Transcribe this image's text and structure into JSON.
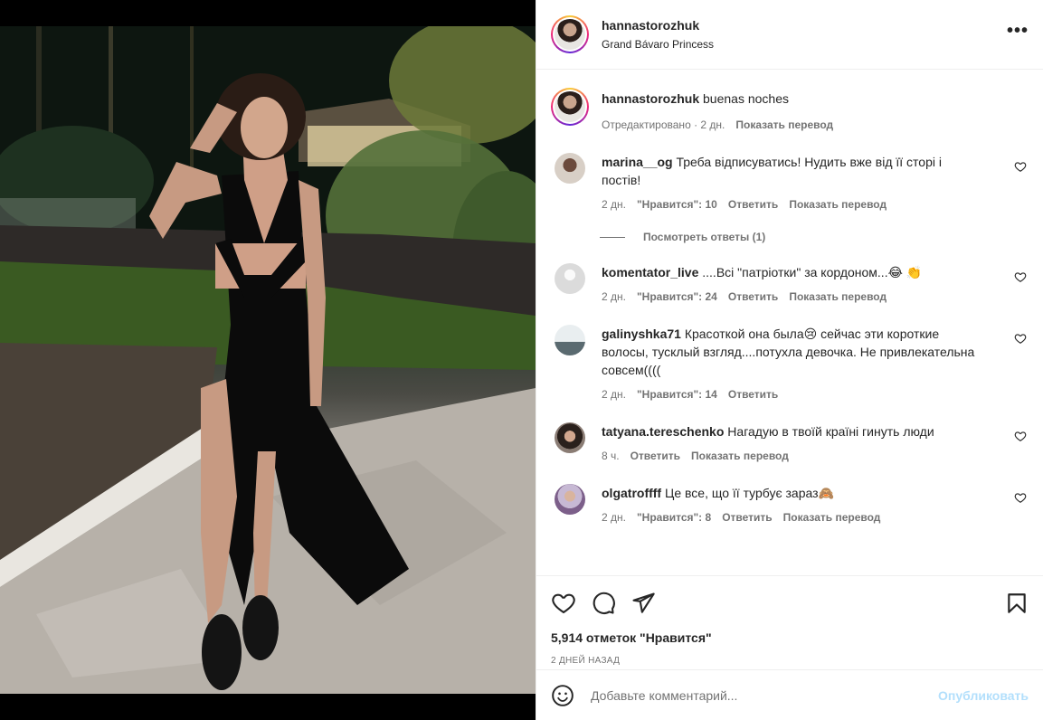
{
  "post": {
    "username": "hannastorozhuk",
    "location": "Grand Bávaro Princess",
    "more_label": "•••"
  },
  "caption": {
    "username": "hannastorozhuk",
    "text": "buenas noches",
    "edited": "Отредактировано · 2 дн.",
    "translate": "Показать перевод"
  },
  "comments": [
    {
      "username": "marina__og",
      "text": "Треба відписуватись! Нудить вже від її сторі і постів!",
      "time": "2 дн.",
      "likes": "\"Нравится\": 10",
      "reply": "Ответить",
      "translate": "Показать перевод",
      "avatar_color": "#d8cfc6"
    },
    {
      "username": "komentator_live",
      "text": "....Всі \"патріотки\" за кордоном...😂 👏",
      "time": "2 дн.",
      "likes": "\"Нравится\": 24",
      "reply": "Ответить",
      "translate": "Показать перевод",
      "avatar_color": "#dbdbdb"
    },
    {
      "username": "galinyshka71",
      "text": "Красоткой она была😢 сейчас эти короткие волосы, тусклый взгляд....потухла девочка. Не привлекательна совсем((((",
      "time": "2 дн.",
      "likes": "\"Нравится\": 14",
      "reply": "Ответить",
      "avatar_color": "#c8d2d6"
    },
    {
      "username": "tatyana.tereschenko",
      "text": "Нагадую в твоїй країні гинуть люди",
      "time": "8 ч.",
      "reply": "Ответить",
      "translate": "Показать перевод",
      "avatar_color": "#6b5a52"
    },
    {
      "username": "olgatroffff",
      "text": "Це все, що її турбує зараз🙈",
      "time": "2 дн.",
      "likes": "\"Нравится\": 8",
      "reply": "Ответить",
      "translate": "Показать перевод",
      "avatar_color": "#a8a0b8"
    }
  ],
  "view_replies": "Посмотреть ответы (1)",
  "stats": {
    "likes": "5,914 отметок \"Нравится\"",
    "date": "2 дней назад"
  },
  "composer": {
    "placeholder": "Добавьте комментарий...",
    "post_label": "Опубликовать"
  },
  "colors": {
    "text": "#262626",
    "muted": "#737373",
    "border": "#efefef",
    "post_disabled": "#b2dffc"
  },
  "icons": [
    "heart-icon",
    "comment-icon",
    "share-icon",
    "bookmark-icon",
    "emoji-icon",
    "more-icon"
  ]
}
